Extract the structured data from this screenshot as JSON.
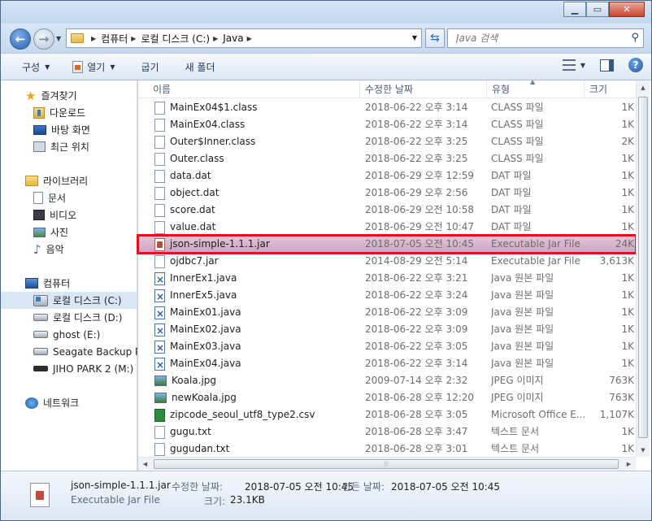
{
  "window": {
    "caption_min": "▁",
    "caption_max": "▭",
    "caption_close": "✕"
  },
  "address": {
    "crumbs": [
      "컴퓨터",
      "로컬 디스크 (C:)",
      "Java"
    ],
    "search_placeholder": "Java 검색"
  },
  "toolbar": {
    "organize": "구성",
    "open": "열기",
    "share": "굽기",
    "new_folder": "새 폴더",
    "help": "?"
  },
  "nav": {
    "favorites": "즐겨찾기",
    "downloads": "다운로드",
    "desktop": "바탕 화면",
    "recent": "최근 위치",
    "libraries": "라이브러리",
    "documents": "문서",
    "videos": "비디오",
    "pictures": "사진",
    "music": "음악",
    "computer": "컴퓨터",
    "drive_c": "로컬 디스크 (C:)",
    "drive_d": "로컬 디스크 (D:)",
    "drive_e": "ghost (E:)",
    "drive_seagate": "Seagate Backup Plu",
    "drive_m": "JIHO PARK 2 (M:)",
    "network": "네트워크"
  },
  "columns": {
    "name": "이름",
    "date": "수정한 날짜",
    "type": "유형",
    "size": "크기"
  },
  "files": [
    {
      "name": "MainEx04$1.class",
      "date": "2018-06-22 오후 3:14",
      "type": "CLASS 파일",
      "size": "1K",
      "icon": "blank"
    },
    {
      "name": "MainEx04.class",
      "date": "2018-06-22 오후 3:14",
      "type": "CLASS 파일",
      "size": "1K",
      "icon": "blank"
    },
    {
      "name": "Outer$Inner.class",
      "date": "2018-06-22 오후 3:25",
      "type": "CLASS 파일",
      "size": "2K",
      "icon": "blank"
    },
    {
      "name": "Outer.class",
      "date": "2018-06-22 오후 3:25",
      "type": "CLASS 파일",
      "size": "1K",
      "icon": "blank"
    },
    {
      "name": "data.dat",
      "date": "2018-06-29 오후 12:59",
      "type": "DAT 파일",
      "size": "1K",
      "icon": "blank"
    },
    {
      "name": "object.dat",
      "date": "2018-06-29 오후 2:56",
      "type": "DAT 파일",
      "size": "1K",
      "icon": "blank"
    },
    {
      "name": "score.dat",
      "date": "2018-06-29 오전 10:58",
      "type": "DAT 파일",
      "size": "1K",
      "icon": "blank"
    },
    {
      "name": "value.dat",
      "date": "2018-06-29 오전 10:47",
      "type": "DAT 파일",
      "size": "1K",
      "icon": "blank"
    },
    {
      "name": "json-simple-1.1.1.jar",
      "date": "2018-07-05 오전 10:45",
      "type": "Executable Jar File",
      "size": "24K",
      "icon": "jar"
    },
    {
      "name": "ojdbc7.jar",
      "date": "2014-08-29 오전 5:14",
      "type": "Executable Jar File",
      "size": "3,613K",
      "icon": "blank"
    },
    {
      "name": "InnerEx1.java",
      "date": "2018-06-22 오후 3:21",
      "type": "Java 원본 파일",
      "size": "1K",
      "icon": "java"
    },
    {
      "name": "InnerEx5.java",
      "date": "2018-06-22 오후 3:24",
      "type": "Java 원본 파일",
      "size": "1K",
      "icon": "java"
    },
    {
      "name": "MainEx01.java",
      "date": "2018-06-22 오후 3:09",
      "type": "Java 원본 파일",
      "size": "1K",
      "icon": "java"
    },
    {
      "name": "MainEx02.java",
      "date": "2018-06-22 오후 3:09",
      "type": "Java 원본 파일",
      "size": "1K",
      "icon": "java"
    },
    {
      "name": "MainEx03.java",
      "date": "2018-06-22 오후 3:05",
      "type": "Java 원본 파일",
      "size": "1K",
      "icon": "java"
    },
    {
      "name": "MainEx04.java",
      "date": "2018-06-22 오후 3:14",
      "type": "Java 원본 파일",
      "size": "1K",
      "icon": "java"
    },
    {
      "name": "Koala.jpg",
      "date": "2009-07-14 오후 2:32",
      "type": "JPEG 이미지",
      "size": "763K",
      "icon": "img"
    },
    {
      "name": "newKoala.jpg",
      "date": "2018-06-28 오후 12:20",
      "type": "JPEG 이미지",
      "size": "763K",
      "icon": "img"
    },
    {
      "name": "zipcode_seoul_utf8_type2.csv",
      "date": "2018-06-28 오후 3:05",
      "type": "Microsoft Office E...",
      "size": "1,107K",
      "icon": "csv"
    },
    {
      "name": "gugu.txt",
      "date": "2018-06-28 오후 3:47",
      "type": "텍스트 문서",
      "size": "1K",
      "icon": "blank"
    },
    {
      "name": "gugudan.txt",
      "date": "2018-06-28 오후 3:01",
      "type": "텍스트 문서",
      "size": "1K",
      "icon": "blank"
    }
  ],
  "highlight_index": 8,
  "details": {
    "filename": "json-simple-1.1.1.jar",
    "filetype": "Executable Jar File",
    "modified_label": "수정한 날짜:",
    "modified_value": "2018-07-05 오전 10:45",
    "created_label": "만든 날짜:",
    "created_value": "2018-07-05 오전 10:45",
    "size_label": "크기:",
    "size_value": "23.1KB"
  },
  "colors": {
    "highlight_outline": "#e3101e",
    "highlight_fill": "#d8b4cc"
  }
}
